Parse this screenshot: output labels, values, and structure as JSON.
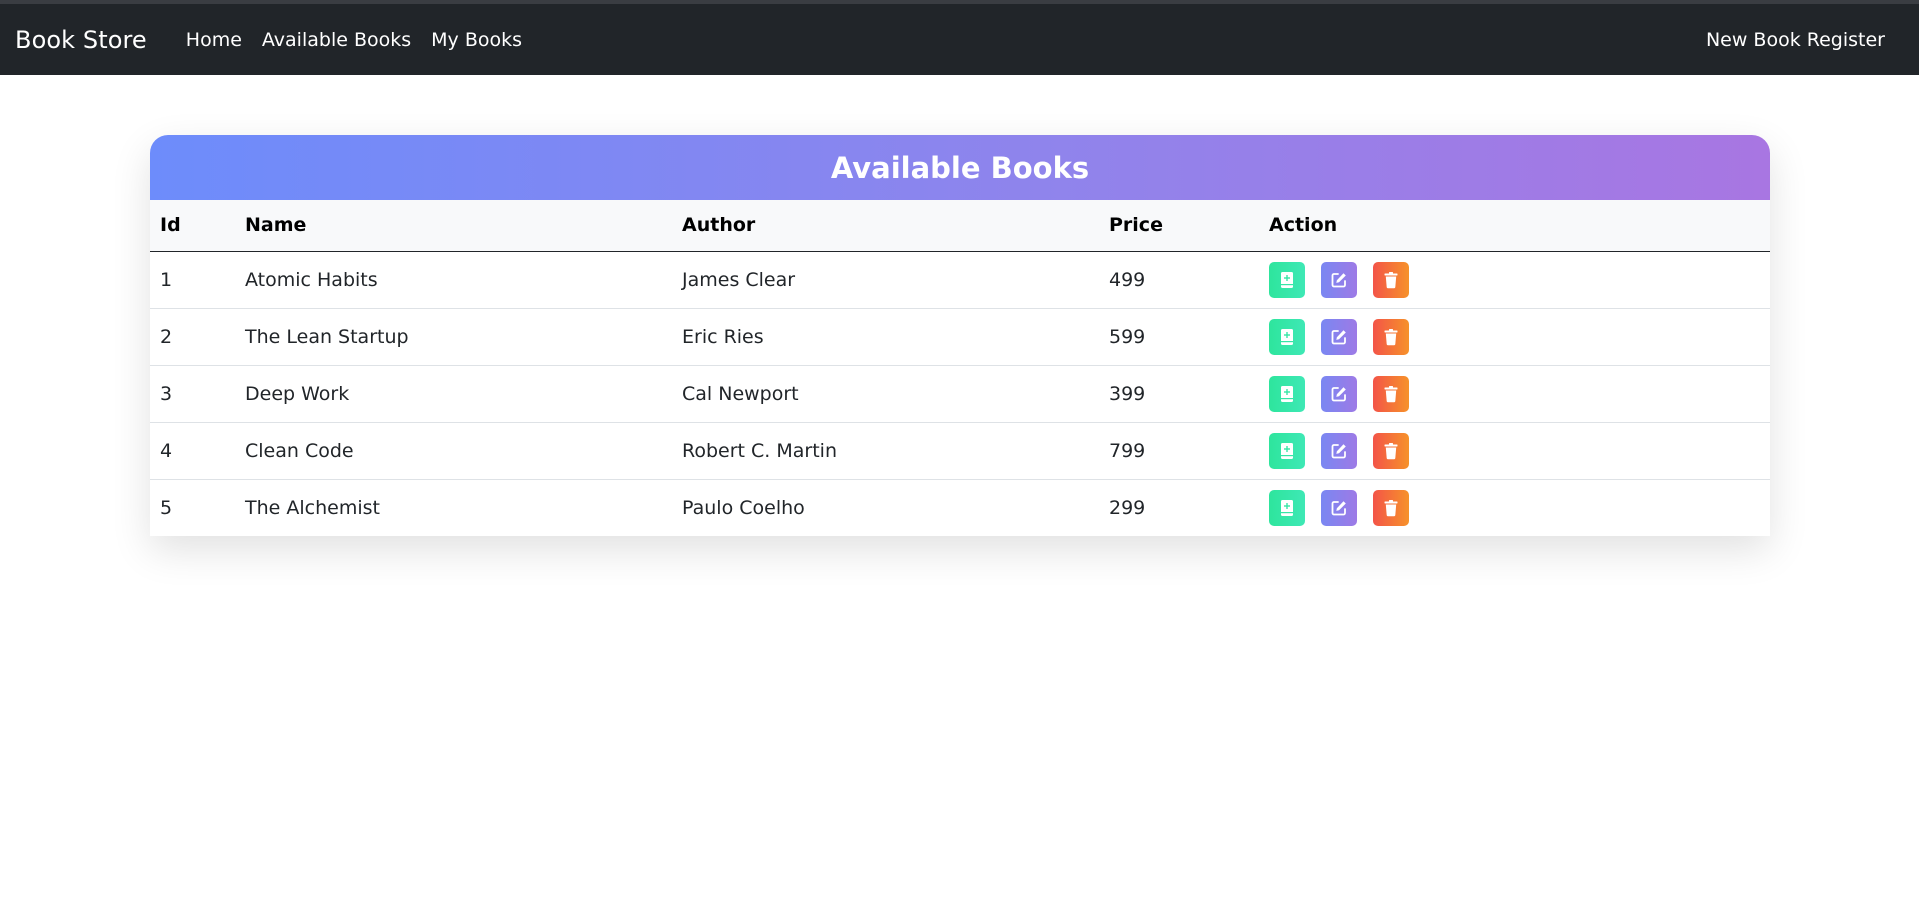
{
  "navbar": {
    "brand": "Book Store",
    "links": [
      {
        "label": "Home"
      },
      {
        "label": "Available Books"
      },
      {
        "label": "My Books"
      }
    ],
    "right_link": "New Book Register"
  },
  "card": {
    "title": "Available Books",
    "columns": [
      "Id",
      "Name",
      "Author",
      "Price",
      "Action"
    ],
    "rows": [
      {
        "id": "1",
        "name": "Atomic Habits",
        "author": "James Clear",
        "price": "499"
      },
      {
        "id": "2",
        "name": "The Lean Startup",
        "author": "Eric Ries",
        "price": "599"
      },
      {
        "id": "3",
        "name": "Deep Work",
        "author": "Cal Newport",
        "price": "399"
      },
      {
        "id": "4",
        "name": "Clean Code",
        "author": "Robert C. Martin",
        "price": "799"
      },
      {
        "id": "5",
        "name": "The Alchemist",
        "author": "Paulo Coelho",
        "price": "299"
      }
    ],
    "action_icons": [
      "book-add-icon",
      "edit-icon",
      "trash-icon"
    ]
  },
  "colors": {
    "navbar_bg": "#212529",
    "header_gradient_start": "#6d8cfb",
    "header_gradient_end": "#a876e2",
    "borrow_button": "#2ee59d",
    "edit_button": "#8a80ec",
    "delete_button": "#f35448"
  }
}
